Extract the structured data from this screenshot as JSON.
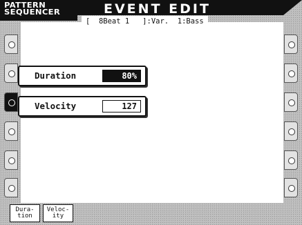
{
  "header": {
    "app_name_line1": "PATTERN",
    "app_name_line2": "SEQUENCER",
    "page_title": "EVENT EDIT",
    "info_line": "[  8Beat 1   ]:Var.  1:Bass"
  },
  "params": [
    {
      "label": "Duration",
      "value": "80%",
      "selected": true
    },
    {
      "label": "Velocity",
      "value": "127",
      "selected": false
    }
  ],
  "soft_buttons": [
    {
      "line1": "Dura-",
      "line2": "tion"
    },
    {
      "line1": "Veloc-",
      "line2": "ity"
    }
  ],
  "colors": {
    "title_bg": "#111111",
    "screen_bg": "#bdbdbd",
    "pane_bg": "#ffffff",
    "selected_value_bg": "#111111"
  }
}
